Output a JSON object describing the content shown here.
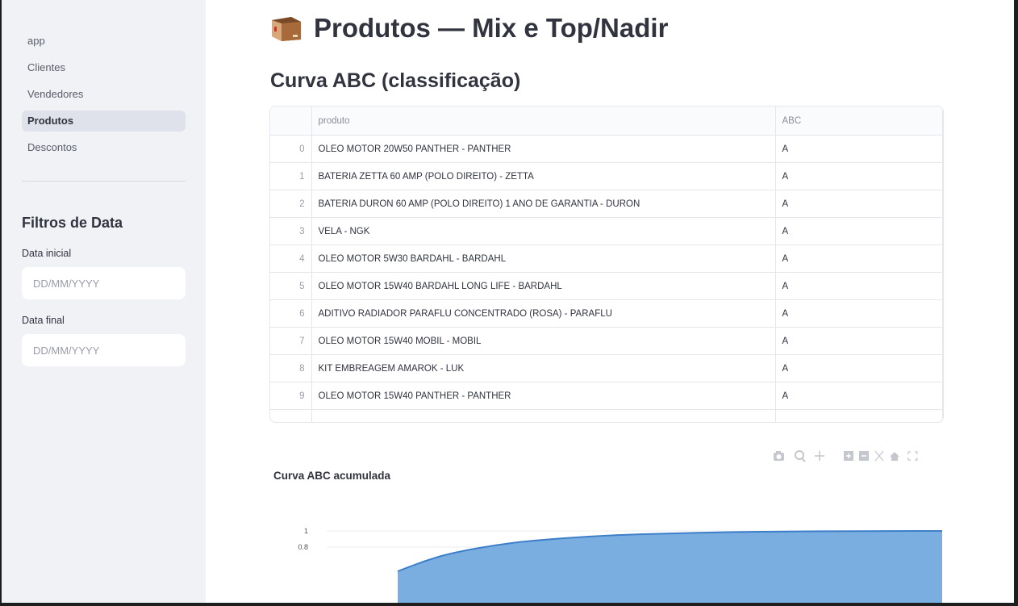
{
  "sidebar": {
    "nav": [
      {
        "label": "app",
        "active": false
      },
      {
        "label": "Clientes",
        "active": false
      },
      {
        "label": "Vendedores",
        "active": false
      },
      {
        "label": "Produtos",
        "active": true
      },
      {
        "label": "Descontos",
        "active": false
      }
    ],
    "filters_title": "Filtros de Data",
    "start_label": "Data inicial",
    "start_placeholder": "DD/MM/YYYY",
    "end_label": "Data final",
    "end_placeholder": "DD/MM/YYYY"
  },
  "main": {
    "title": "Produtos — Mix e Top/Nadir",
    "title_icon": "package-icon",
    "section_title": "Curva ABC (classificação)",
    "table": {
      "columns": [
        "",
        "produto",
        "ABC"
      ],
      "rows": [
        [
          "0",
          "OLEO MOTOR 20W50 PANTHER - PANTHER",
          "A"
        ],
        [
          "1",
          "BATERIA ZETTA 60 AMP (POLO DIREITO) - ZETTA",
          "A"
        ],
        [
          "2",
          "BATERIA DURON 60 AMP (POLO DIREITO) 1 ANO DE GARANTIA - DURON",
          "A"
        ],
        [
          "3",
          "VELA - NGK",
          "A"
        ],
        [
          "4",
          "OLEO MOTOR 5W30 BARDAHL - BARDAHL",
          "A"
        ],
        [
          "5",
          "OLEO MOTOR 15W40 BARDAHL LONG LIFE - BARDAHL",
          "A"
        ],
        [
          "6",
          "ADITIVO RADIADOR PARAFLU CONCENTRADO (ROSA) - PARAFLU",
          "A"
        ],
        [
          "7",
          "OLEO MOTOR 15W40 MOBIL - MOBIL",
          "A"
        ],
        [
          "8",
          "KIT EMBREAGEM AMAROK - LUK",
          "A"
        ],
        [
          "9",
          "OLEO MOTOR 15W40 PANTHER - PANTHER",
          "A"
        ]
      ]
    },
    "modebar_icons": [
      "camera-icon",
      "zoom-icon",
      "pan-icon",
      "zoom-in-icon",
      "zoom-out-icon",
      "autoscale-icon",
      "home-icon",
      "fullscreen-icon"
    ]
  },
  "chart_data": {
    "type": "area",
    "title": "Curva ABC acumulada",
    "ylabel": "",
    "yticks": [
      "1",
      "0.8"
    ],
    "color": "#7aaee0",
    "line_color": "#3d7fc9",
    "ylim_visible": [
      0.5,
      1.0
    ],
    "x": [
      0,
      0.05,
      0.1,
      0.2,
      0.3,
      0.4,
      0.5,
      0.6,
      0.7,
      0.8,
      0.9,
      1.0
    ],
    "values": [
      0.5,
      0.63,
      0.73,
      0.85,
      0.91,
      0.95,
      0.97,
      0.985,
      0.993,
      0.997,
      0.999,
      1.0
    ]
  }
}
